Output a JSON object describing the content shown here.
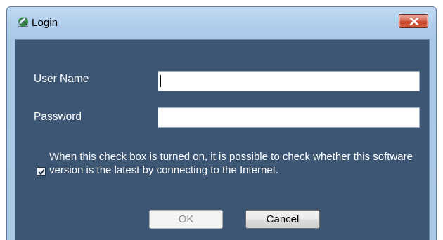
{
  "window": {
    "title": "Login",
    "icon": "satellite-dish-icon",
    "close_icon": "close-icon"
  },
  "form": {
    "username_label": "User Name",
    "username_value": "",
    "password_label": "Password",
    "password_value": "",
    "check_label": "When this check box is turned on, it is possible to check whether this software version is the latest by connecting to the Internet.",
    "check_checked": true
  },
  "buttons": {
    "ok_label": "OK",
    "ok_enabled": false,
    "cancel_label": "Cancel"
  },
  "colors": {
    "client_background": "#3d5673",
    "frame": "#aac9e6",
    "close_button": "#c7452c"
  }
}
